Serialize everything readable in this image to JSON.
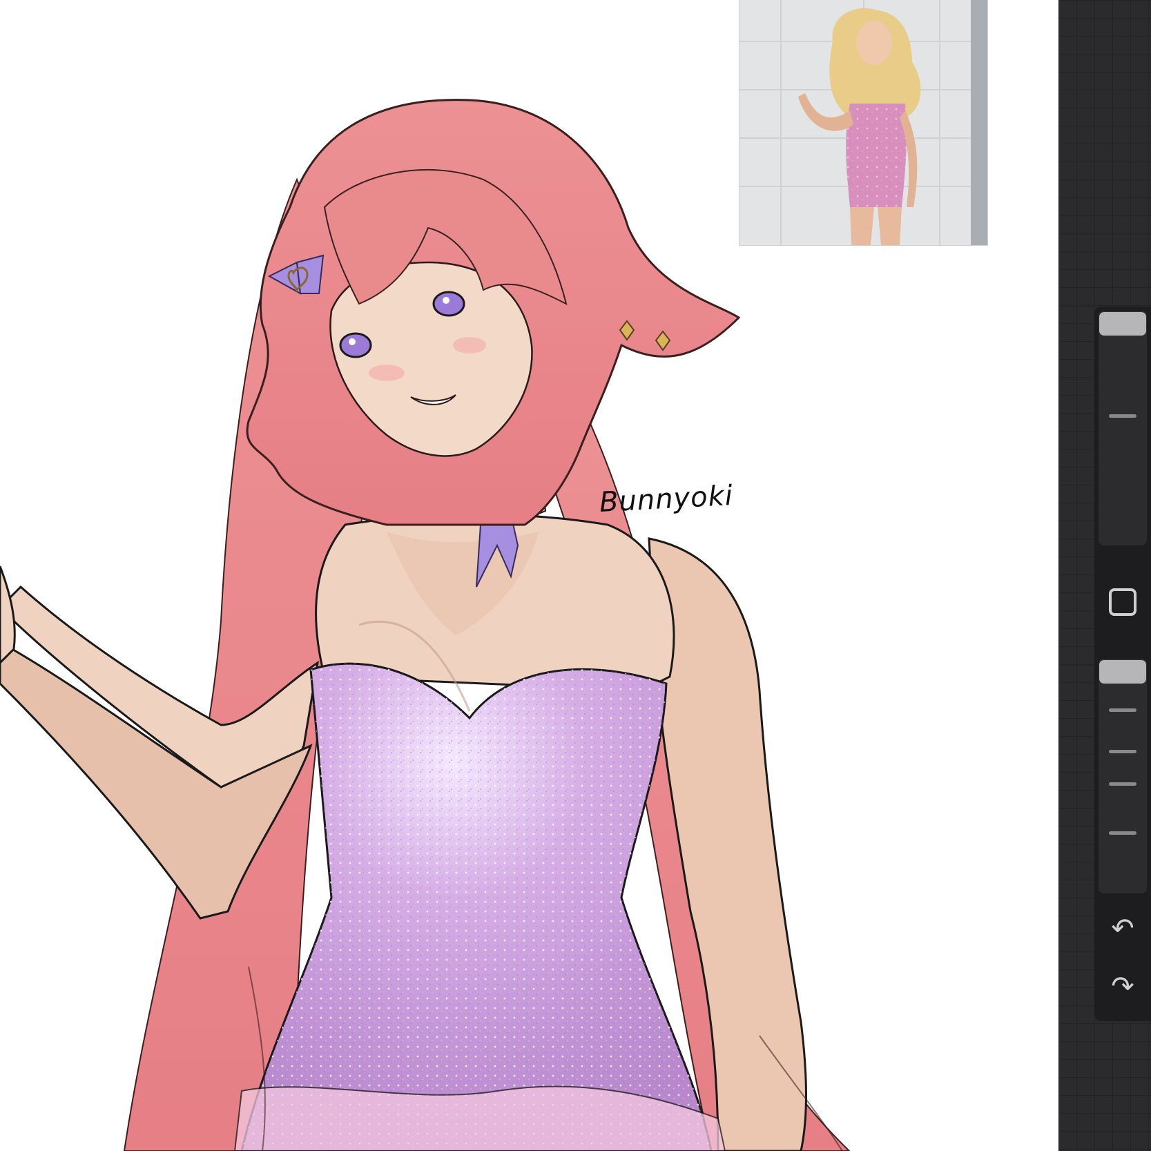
{
  "canvas": {
    "signature": "Bunnyoki"
  },
  "reference_image": {
    "description_icon": "reference-photo-icon"
  },
  "sidebar": {
    "brush_size": {
      "name": "brush-size-slider",
      "level": 1.0
    },
    "modify_button_icon": "square-icon",
    "brush_opacity": {
      "name": "brush-opacity-slider",
      "level": 1.0
    },
    "undo_icon": "undo-arrow-icon",
    "redo_icon": "redo-arrow-icon",
    "undo_glyph": "↶",
    "redo_glyph": "↷"
  },
  "colors": {
    "hair": "#e8888a",
    "skin": "#f0d2c0",
    "dress": "#c59ad8",
    "ribbon": "#a68ee0",
    "toolbar": "#1d1d1f"
  }
}
